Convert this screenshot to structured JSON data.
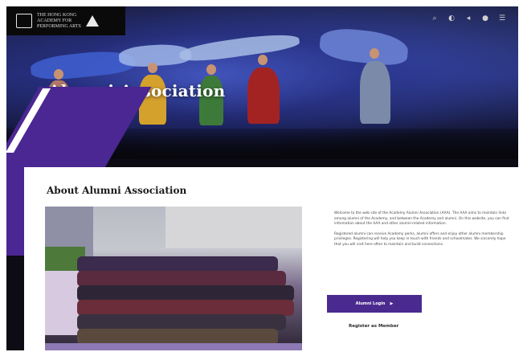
{
  "header": {
    "logo_text_line1": "THE HONG KONG",
    "logo_text_line2": "ACADEMY FOR",
    "logo_text_line3": "PERFORMING ARTS",
    "utility_icons": [
      "search-icon",
      "language-icon",
      "share-icon",
      "user-icon",
      "menu-icon"
    ]
  },
  "hero": {
    "title": "Alumni Association"
  },
  "about": {
    "title": "About Alumni Association",
    "paragraph1": "Welcome to the web site of the Academy Alumni Association (AAA). The AAA aims to maintain links among alumni of the Academy, and between the Academy and alumni. On this website, you can find information about the AAA and other alumni-related information.",
    "paragraph2": "Registered alumni can receive Academy perks, alumni offers and enjoy other alumni membership privileges. Registering will help you keep in touch with friends and schoolmates. We sincerely hope that you will visit here often to maintain and build connections.",
    "login_label": "Alumni Login",
    "register_label": "Register as Member"
  },
  "colors": {
    "accent_purple": "#4b2a8f",
    "hero_dark": "#0d0b14"
  }
}
